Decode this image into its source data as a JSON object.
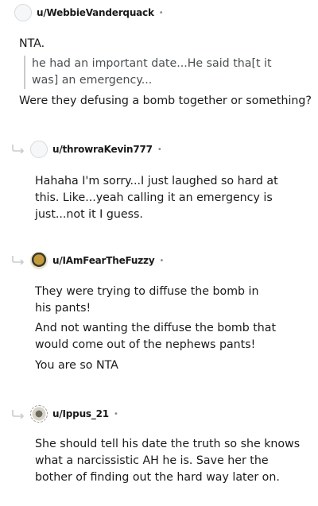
{
  "comments": [
    {
      "username": "u/WebbieVanderquack",
      "dot": "•",
      "paragraphs": [
        "NTA."
      ],
      "quote": "he had an important date...He said tha[t it was] an emergency...",
      "after_quote": "Were they defusing a bomb together or something?"
    },
    {
      "username": "u/throwraKevin777",
      "dot": "•",
      "paragraphs": [
        "Hahaha I'm sorry...I just laughed so hard at this. Like...yeah calling it an emergency is just...not it I guess."
      ]
    },
    {
      "username": "u/IAmFearTheFuzzy",
      "dot": "•",
      "paragraphs": [
        "They were trying to diffuse the bomb in his pants!",
        "And not wanting the diffuse the bomb that would come out of the nephews pants!",
        "You are so NTA"
      ]
    },
    {
      "username": "u/Ippus_21",
      "dot": "•",
      "paragraphs": [
        "She should tell his date the truth so she knows what a narcissistic AH he is. Save her the bother of finding out the hard way later on."
      ]
    }
  ]
}
